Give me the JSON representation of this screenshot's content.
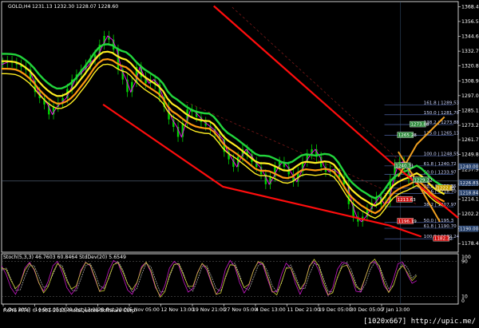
{
  "header": {
    "symbol": "GOLD,H4",
    "ohlc": "1231.13 1232.30 1228.07 1228.60"
  },
  "indicator_label": "Stoch(5,3,3) 46.7603 60.8464  StdDev(20) 5.6549",
  "copyright": "FxPro MT4, © 2001-2013, MetaQuotes Software Corp.",
  "watermark": "[1020x667] http://upic.me/",
  "colors": {
    "background": "#000000",
    "axis": "#ffffff",
    "candle": "#00d400",
    "price_line": "#ff00ff",
    "ribbon_green": "#22d63c",
    "ribbon_yellow": "#ffee22",
    "ribbon_orange": "#ff9a10",
    "channel": "#ff0d0d",
    "forecast": "#f0a020",
    "fib": "#5b76c4",
    "current_price": "#5b6c82"
  },
  "chart_data": {
    "type": "line",
    "symbol": "GOLD,H4",
    "yticks": [
      "1368.45",
      "1356.55",
      "1344.65",
      "1332.75",
      "1320.85",
      "1308.95",
      "1297.05",
      "1285.15",
      "1273.25",
      "1261.70",
      "1249.80",
      "1237.90",
      "1226.00",
      "1214.10",
      "1202.20",
      "1190.30",
      "1178.40"
    ],
    "ylim": [
      1171.5,
      1372.5
    ],
    "xticks": [
      "4 Oct 2013",
      "14 Oct 05:00",
      "21 Oct 13:00",
      "28 Oct 20:00",
      "5 Nov 05:00",
      "12 Nov 13:00",
      "19 Nov 21:00",
      "27 Nov 05:00",
      "4 Dec 13:00",
      "11 Dec 21:00",
      "19 Dec 05:00",
      "30 Dec 05:00",
      "7 Jan 13:00"
    ],
    "price": {
      "name": "GOLD,H4",
      "points": [
        [
          0,
          1322
        ],
        [
          2,
          1325
        ],
        [
          4,
          1322
        ],
        [
          6,
          1318
        ],
        [
          8,
          1300
        ],
        [
          10,
          1290
        ],
        [
          11,
          1282
        ],
        [
          12,
          1288
        ],
        [
          14,
          1295
        ],
        [
          16,
          1310
        ],
        [
          18,
          1318
        ],
        [
          20,
          1326
        ],
        [
          21,
          1330
        ],
        [
          22,
          1338
        ],
        [
          23,
          1345
        ],
        [
          24,
          1342
        ],
        [
          25,
          1334
        ],
        [
          26,
          1318
        ],
        [
          27,
          1310
        ],
        [
          28,
          1300
        ],
        [
          29,
          1308
        ],
        [
          30,
          1320
        ],
        [
          31,
          1312
        ],
        [
          32,
          1307
        ],
        [
          33,
          1310
        ],
        [
          34,
          1306
        ],
        [
          35,
          1296
        ],
        [
          36,
          1288
        ],
        [
          37,
          1278
        ],
        [
          38,
          1272
        ],
        [
          39,
          1264
        ],
        [
          40,
          1275
        ],
        [
          41,
          1286
        ],
        [
          42,
          1284
        ],
        [
          43,
          1280
        ],
        [
          44,
          1276
        ],
        [
          46,
          1270
        ],
        [
          48,
          1262
        ],
        [
          49,
          1252
        ],
        [
          50,
          1246
        ],
        [
          51,
          1240
        ],
        [
          52,
          1248
        ],
        [
          53,
          1254
        ],
        [
          54,
          1250
        ],
        [
          55,
          1244
        ],
        [
          56,
          1240
        ],
        [
          57,
          1234
        ],
        [
          58,
          1226
        ],
        [
          59,
          1232
        ],
        [
          60,
          1240
        ],
        [
          61,
          1244
        ],
        [
          62,
          1240
        ],
        [
          63,
          1234
        ],
        [
          64,
          1228
        ],
        [
          65,
          1236
        ],
        [
          66,
          1244
        ],
        [
          67,
          1250
        ],
        [
          68,
          1254
        ],
        [
          69,
          1248
        ],
        [
          70,
          1240
        ],
        [
          71,
          1236
        ],
        [
          72,
          1238
        ],
        [
          73,
          1235
        ],
        [
          74,
          1232
        ],
        [
          75,
          1226
        ],
        [
          76,
          1210
        ],
        [
          77,
          1200
        ],
        [
          78,
          1196
        ],
        [
          79,
          1200
        ],
        [
          80,
          1206
        ],
        [
          81,
          1211
        ],
        [
          82,
          1216
        ],
        [
          83,
          1210
        ],
        [
          84,
          1212
        ],
        [
          85,
          1230
        ],
        [
          86,
          1242
        ],
        [
          87,
          1244
        ],
        [
          88,
          1238
        ],
        [
          89,
          1230
        ],
        [
          90,
          1228
        ]
      ]
    },
    "channel": {
      "upper": [
        [
          46,
          1369
        ],
        [
          84,
          1245
        ],
        [
          99,
          1199
        ]
      ],
      "lower": [
        [
          22,
          1290
        ],
        [
          48,
          1224
        ],
        [
          84,
          1193
        ],
        [
          91,
          1184
        ]
      ]
    },
    "forecast_lines": [
      {
        "points": [
          [
            86,
            1232
          ],
          [
            90,
            1258
          ],
          [
            96,
            1280
          ]
        ]
      },
      {
        "points": [
          [
            86,
            1252
          ],
          [
            90,
            1228
          ],
          [
            95,
            1196
          ]
        ]
      }
    ],
    "fib_levels": [
      {
        "label": "161.8 | 1289.53",
        "price": 1289.53
      },
      {
        "label": "150.0 | 1281.70",
        "price": 1281.7
      },
      {
        "label": "138.2 | 1273.88",
        "price": 1273.88
      },
      {
        "label": "125.0 | 1265.13",
        "price": 1265.13
      },
      {
        "label": "100.0 | 1248.55",
        "price": 1248.55
      },
      {
        "label": "61.8 | 1240.72",
        "price": 1240.72
      },
      {
        "label": "50.0 | 1233.97",
        "price": 1233.97
      },
      {
        "label": "38.2 | 1222.85",
        "price": 1222.85
      },
      {
        "label": "23.6 | 1218.70",
        "price": 1218.7
      },
      {
        "label": "38.2 | 1207.97",
        "price": 1207.97
      },
      {
        "label": "50.0 | 1195.3",
        "price": 1195.3
      },
      {
        "label": "61.8 | 1190.70",
        "price": 1190.7
      },
      {
        "label": "100.0 | 1182.24",
        "price": 1182.24
      }
    ],
    "tags": [
      {
        "text": "1273.88",
        "price": 1273.88,
        "color": "#2e8b3c"
      },
      {
        "text": "1265.28",
        "price": 1265.28,
        "color": "#2e8b3c"
      },
      {
        "text": "1240.71",
        "price": 1240.71,
        "color": "#2e8b3c"
      },
      {
        "text": "1229.22",
        "price": 1229.22,
        "color": "#2e8b3c"
      },
      {
        "text": "1222.85",
        "price": 1222.85,
        "color": "#c8a000"
      },
      {
        "text": "1213.63",
        "price": 1213.63,
        "color": "#cc1010"
      },
      {
        "text": "1196.19",
        "price": 1196.19,
        "color": "#cc1010"
      },
      {
        "text": "1182.32",
        "price": 1182.32,
        "color": "#cc1010"
      }
    ],
    "axis_tags": [
      {
        "text": "1240.00",
        "price": 1240.0
      },
      {
        "text": "1226.83",
        "price": 1226.83
      },
      {
        "text": "1218.84",
        "price": 1218.84
      },
      {
        "text": "1190.00",
        "price": 1190.0
      }
    ],
    "stoch": {
      "ylim": [
        0,
        100
      ],
      "yticks": [
        100,
        90,
        10,
        0
      ],
      "main": [
        80,
        60,
        30,
        15,
        40,
        75,
        88,
        70,
        40,
        22,
        45,
        80,
        90,
        65,
        30,
        15,
        30,
        70,
        88,
        80,
        50,
        22,
        35,
        70,
        92,
        85,
        55,
        25,
        15,
        40,
        78,
        88,
        65,
        30,
        12,
        35,
        75,
        90,
        80,
        45,
        20,
        28,
        65,
        85,
        70,
        40,
        15,
        30,
        72,
        92,
        78,
        42,
        18,
        35,
        70,
        88,
        82,
        50,
        20,
        22,
        60,
        86,
        75,
        40,
        15,
        40,
        80,
        90,
        70,
        35,
        12,
        30,
        72,
        88,
        85,
        55,
        22,
        20,
        55,
        85,
        90,
        70,
        35,
        20,
        50,
        85,
        88,
        60,
        40,
        46
      ],
      "signal": [
        70,
        75,
        50,
        25,
        25,
        55,
        80,
        80,
        55,
        30,
        35,
        60,
        85,
        80,
        50,
        25,
        22,
        50,
        80,
        85,
        65,
        35,
        28,
        52,
        82,
        90,
        70,
        40,
        20,
        28,
        60,
        85,
        78,
        48,
        20,
        22,
        55,
        82,
        86,
        62,
        32,
        22,
        48,
        78,
        80,
        55,
        28,
        22,
        52,
        82,
        86,
        60,
        30,
        25,
        52,
        80,
        86,
        68,
        35,
        20,
        40,
        75,
        82,
        58,
        28,
        28,
        60,
        85,
        82,
        52,
        22,
        20,
        52,
        82,
        88,
        70,
        38,
        20,
        38,
        70,
        88,
        80,
        52,
        28,
        35,
        68,
        86,
        76,
        52,
        61
      ]
    }
  }
}
